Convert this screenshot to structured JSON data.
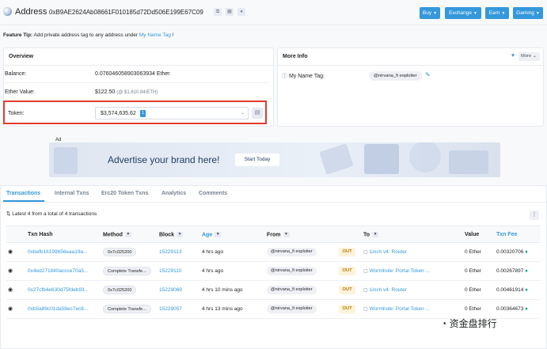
{
  "header": {
    "title": "Address",
    "hash": "0xB9AE2624Ab08661F010185d72Dd506E199E67C09",
    "buttons": [
      "Buy",
      "Exchange",
      "Earn",
      "Gaming"
    ],
    "accent": "#3498db"
  },
  "tip": {
    "bold": "Feature Tip:",
    "text": "Add private address tag to any address under",
    "link": "My Name Tag",
    "suffix": "!"
  },
  "overview": {
    "title": "Overview",
    "balance_label": "Balance:",
    "balance_value": "0.076046058903063934 Ether",
    "ether_value_label": "Ether Value:",
    "ether_value": "$122.50",
    "ether_rate": "(@ $1,610.84/ETH)",
    "token_label": "Token:",
    "token_value": "$3,574,635.62",
    "token_count": "1"
  },
  "more_info": {
    "title": "More Info",
    "more_label": "More",
    "name_tag_label": "My Name Tag:",
    "name_tag_value": "@nirvana_fi exploiter"
  },
  "ad": {
    "label": "Ad",
    "headline": "Advertise your brand here!",
    "cta": "Start Today"
  },
  "tabs": [
    "Transactions",
    "Internal Txns",
    "Erc20 Token Txns",
    "Analytics",
    "Comments"
  ],
  "table": {
    "summary": "Latest 4 from a total of 4 transactions",
    "headers": [
      "Txn Hash",
      "Method",
      "Block",
      "Age",
      "From",
      "To",
      "Value",
      "Txn Fee"
    ],
    "rows": [
      {
        "hash": "0xbefb16199b56eaa19a...",
        "method": "0x7c025200",
        "block": "15229113",
        "age": "4 hrs ago",
        "from": "@nirvana_fi exploiter",
        "dir": "OUT",
        "to": "1inch v4: Router",
        "value": "0 Ether",
        "fee": "0.00320706"
      },
      {
        "hash": "0x4ed271840accce70a5...",
        "method": "Complete Transfe...",
        "block": "15229110",
        "age": "4 hrs ago",
        "from": "@nirvana_fi exploiter",
        "dir": "OUT",
        "to": "Wormhole: Portal Token ...",
        "value": "0 Ether",
        "fee": "0.00267897"
      },
      {
        "hash": "0x27cfb4e630d75fdeb93...",
        "method": "0x7c025200",
        "block": "15229069",
        "age": "4 hrs 10 mins ago",
        "from": "@nirvana_fi exploiter",
        "dir": "OUT",
        "to": "1inch v4: Router",
        "value": "0 Ether",
        "fee": "0.00461914"
      },
      {
        "hash": "0xb5a89c01da58ec7ec8...",
        "method": "Complete Transfe...",
        "block": "15229057",
        "age": "4 hrs 13 mins ago",
        "from": "@nirvana_fi exploiter",
        "dir": "OUT",
        "to": "Wormhole: Portal Token ...",
        "value": "0 Ether",
        "fee": "0.00364673"
      }
    ]
  },
  "watermark": "资金盘排行"
}
